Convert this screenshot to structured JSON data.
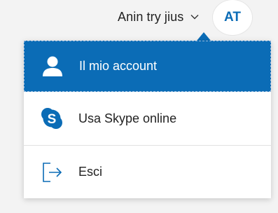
{
  "header": {
    "user_name": "Anin try jius",
    "avatar_initials": "AT"
  },
  "menu": {
    "items": [
      {
        "label": "Il mio account",
        "icon": "person-icon"
      },
      {
        "label": "Usa Skype online",
        "icon": "skype-icon"
      },
      {
        "label": "Esci",
        "icon": "sign-out-icon"
      }
    ]
  },
  "colors": {
    "accent": "#0b6cb6",
    "skype": "#0b6cb6",
    "text": "#222222"
  }
}
